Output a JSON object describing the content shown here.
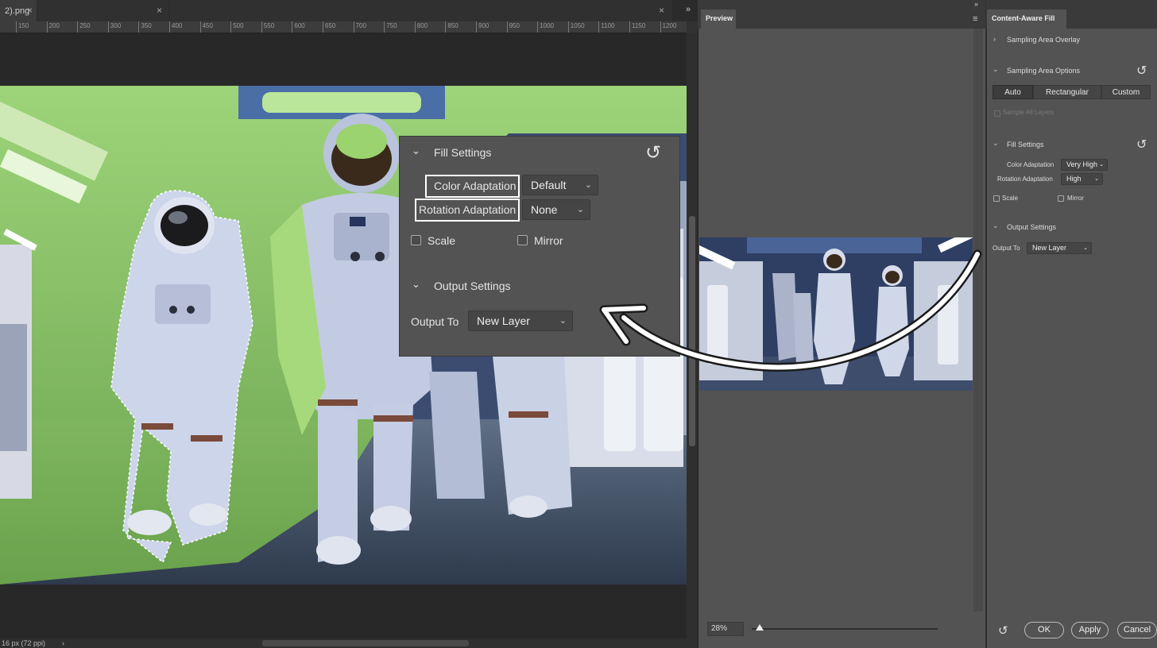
{
  "tabs": [
    {
      "label": "2).png",
      "close": "×"
    },
    {
      "label": "",
      "close": "×"
    },
    {
      "label": "",
      "close": "×"
    }
  ],
  "ruler_ticks": [
    "150",
    "200",
    "250",
    "300",
    "350",
    "400",
    "450",
    "500",
    "550",
    "600",
    "650",
    "700",
    "750",
    "800",
    "850",
    "900",
    "950",
    "1000",
    "1050",
    "1100",
    "1150",
    "1200"
  ],
  "status": {
    "doc_info": "16 px (72 ppi)",
    "arrow": "›"
  },
  "callout": {
    "fill_title": "Fill Settings",
    "color_adaptation_label": "Color Adaptation",
    "color_adaptation_value": "Default",
    "rotation_adaptation_label": "Rotation Adaptation",
    "rotation_adaptation_value": "None",
    "scale_label": "Scale",
    "mirror_label": "Mirror",
    "output_title": "Output Settings",
    "output_to_label": "Output To",
    "output_to_value": "New Layer"
  },
  "preview": {
    "tab": "Preview",
    "zoom": "28%"
  },
  "panel": {
    "tab": "Content-Aware Fill",
    "sampling_overlay": "Sampling Area Overlay",
    "sampling_options": "Sampling Area Options",
    "seg_auto": "Auto",
    "seg_rect": "Rectangular",
    "seg_custom": "Custom",
    "sample_all_layers": "Sample All Layers",
    "fill_settings": "Fill Settings",
    "color_adaptation_label": "Color Adaptation",
    "color_adaptation_value": "Very High",
    "rotation_adaptation_label": "Rotation Adaptation",
    "rotation_adaptation_value": "High",
    "scale_label": "Scale",
    "mirror_label": "Mirror",
    "output_settings": "Output Settings",
    "output_to_label": "Output To",
    "output_to_value": "New Layer",
    "ok": "OK",
    "apply": "Apply",
    "cancel": "Cancel"
  },
  "icons": {
    "collapse_right": "»",
    "panel_menu": "≡",
    "reset": "↺",
    "chevron_down": "⌄",
    "chevron_right": "›"
  },
  "colors": {
    "green_overlay": "#8fd468",
    "suit": "#c8d0e6",
    "panel": "#535353"
  }
}
